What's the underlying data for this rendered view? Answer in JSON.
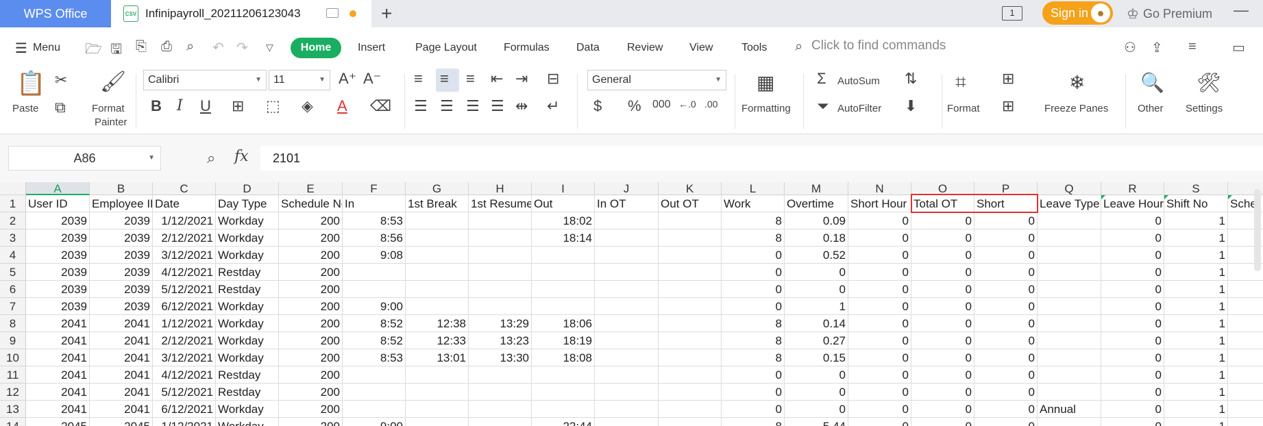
{
  "titlebar": {
    "app_name": "WPS Office",
    "doc_badge": "CSV",
    "doc_title": "Infinipayroll_20211206123043",
    "page_count": "1",
    "signin_label": "Sign in",
    "premium_label": "Go Premium"
  },
  "menu": {
    "menu_label": "Menu",
    "tabs": [
      "Home",
      "Insert",
      "Page Layout",
      "Formulas",
      "Data",
      "Review",
      "View",
      "Tools"
    ],
    "find_placeholder": "Click to find commands"
  },
  "ribbon": {
    "paste": "Paste",
    "format_painter": "Format",
    "format_painter2": "Painter",
    "font_name": "Calibri",
    "font_size": "11",
    "number_format": "General",
    "formatting": "Formatting",
    "autosum": "AutoSum",
    "autofilter": "AutoFilter",
    "format": "Format",
    "freeze_panes": "Freeze Panes",
    "other": "Other",
    "settings": "Settings"
  },
  "formula_bar": {
    "cell_ref": "A86",
    "fx": "fx",
    "value": "2101"
  },
  "sheet": {
    "columns": [
      "A",
      "B",
      "C",
      "D",
      "E",
      "F",
      "G",
      "H",
      "I",
      "J",
      "K",
      "L",
      "M",
      "N",
      "O",
      "P",
      "Q",
      "R",
      "S"
    ],
    "extra_col_header": "Sche",
    "header_row": [
      "User ID",
      "Employee ID",
      "Date",
      "Day Type",
      "Schedule No",
      "In",
      "1st Break",
      "1st Resume",
      "Out",
      "In OT",
      "Out OT",
      "Work",
      "Overtime",
      "Short Hour",
      "Total OT",
      "Short",
      "Leave Type",
      "Leave Hour",
      "Shift No"
    ],
    "rows": [
      {
        "n": "2",
        "c": [
          "2039",
          "2039",
          "1/12/2021",
          "Workday",
          "200",
          "8:53",
          "",
          "",
          "18:02",
          "",
          "",
          "8",
          "0.09",
          "0",
          "0",
          "0",
          "",
          "0",
          "1"
        ]
      },
      {
        "n": "3",
        "c": [
          "2039",
          "2039",
          "2/12/2021",
          "Workday",
          "200",
          "8:56",
          "",
          "",
          "18:14",
          "",
          "",
          "8",
          "0.18",
          "0",
          "0",
          "0",
          "",
          "0",
          "1"
        ]
      },
      {
        "n": "4",
        "c": [
          "2039",
          "2039",
          "3/12/2021",
          "Workday",
          "200",
          "9:08",
          "",
          "",
          "",
          "",
          "",
          "0",
          "0.52",
          "0",
          "0",
          "0",
          "",
          "0",
          "1"
        ]
      },
      {
        "n": "5",
        "c": [
          "2039",
          "2039",
          "4/12/2021",
          "Restday",
          "200",
          "",
          "",
          "",
          "",
          "",
          "",
          "0",
          "0",
          "0",
          "0",
          "0",
          "",
          "0",
          "1"
        ]
      },
      {
        "n": "6",
        "c": [
          "2039",
          "2039",
          "5/12/2021",
          "Restday",
          "200",
          "",
          "",
          "",
          "",
          "",
          "",
          "0",
          "0",
          "0",
          "0",
          "0",
          "",
          "0",
          "1"
        ]
      },
      {
        "n": "7",
        "c": [
          "2039",
          "2039",
          "6/12/2021",
          "Workday",
          "200",
          "9:00",
          "",
          "",
          "",
          "",
          "",
          "0",
          "1",
          "0",
          "0",
          "0",
          "",
          "0",
          "1"
        ]
      },
      {
        "n": "8",
        "c": [
          "2041",
          "2041",
          "1/12/2021",
          "Workday",
          "200",
          "8:52",
          "12:38",
          "13:29",
          "18:06",
          "",
          "",
          "8",
          "0.14",
          "0",
          "0",
          "0",
          "",
          "0",
          "1"
        ]
      },
      {
        "n": "9",
        "c": [
          "2041",
          "2041",
          "2/12/2021",
          "Workday",
          "200",
          "8:52",
          "12:33",
          "13:23",
          "18:19",
          "",
          "",
          "8",
          "0.27",
          "0",
          "0",
          "0",
          "",
          "0",
          "1"
        ]
      },
      {
        "n": "10",
        "c": [
          "2041",
          "2041",
          "3/12/2021",
          "Workday",
          "200",
          "8:53",
          "13:01",
          "13:30",
          "18:08",
          "",
          "",
          "8",
          "0.15",
          "0",
          "0",
          "0",
          "",
          "0",
          "1"
        ]
      },
      {
        "n": "11",
        "c": [
          "2041",
          "2041",
          "4/12/2021",
          "Restday",
          "200",
          "",
          "",
          "",
          "",
          "",
          "",
          "0",
          "0",
          "0",
          "0",
          "0",
          "",
          "0",
          "1"
        ]
      },
      {
        "n": "12",
        "c": [
          "2041",
          "2041",
          "5/12/2021",
          "Restday",
          "200",
          "",
          "",
          "",
          "",
          "",
          "",
          "0",
          "0",
          "0",
          "0",
          "0",
          "",
          "0",
          "1"
        ]
      },
      {
        "n": "13",
        "c": [
          "2041",
          "2041",
          "6/12/2021",
          "Workday",
          "200",
          "",
          "",
          "",
          "",
          "",
          "",
          "0",
          "0",
          "0",
          "0",
          "0",
          "Annual",
          "0",
          "1"
        ]
      },
      {
        "n": "14",
        "c": [
          "2045",
          "2045",
          "1/12/2021",
          "Workday",
          "200",
          "9:00",
          "",
          "",
          "22:44",
          "",
          "",
          "8",
          "5.44",
          "0",
          "0",
          "0",
          "",
          "0",
          "1"
        ]
      }
    ]
  }
}
